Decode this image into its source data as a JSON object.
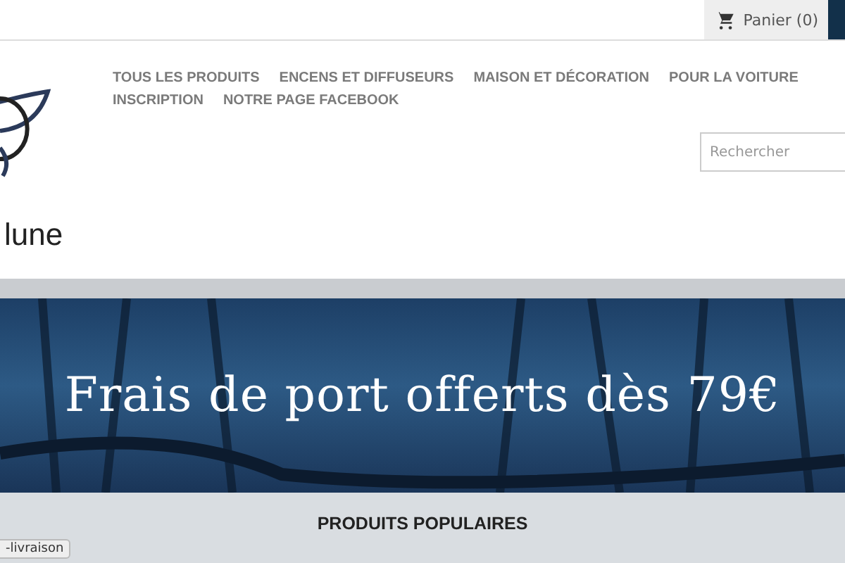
{
  "top_bar": {
    "cart": {
      "label": "Panier (0)"
    }
  },
  "logo": {
    "text": "lune"
  },
  "nav": {
    "items": [
      {
        "label": "TOUS LES PRODUITS"
      },
      {
        "label": "ENCENS ET DIFFUSEURS"
      },
      {
        "label": "MAISON ET DÉCORATION"
      },
      {
        "label": "POUR LA VOITURE"
      },
      {
        "label": "INSCRIPTION"
      },
      {
        "label": "NOTRE PAGE FACEBOOK"
      }
    ]
  },
  "search": {
    "placeholder": "Rechercher"
  },
  "banner": {
    "text": "Frais de port offerts dès 79€"
  },
  "section": {
    "title": "PRODUITS POPULAIRES"
  },
  "status_tooltip": {
    "text": "-livraison"
  }
}
